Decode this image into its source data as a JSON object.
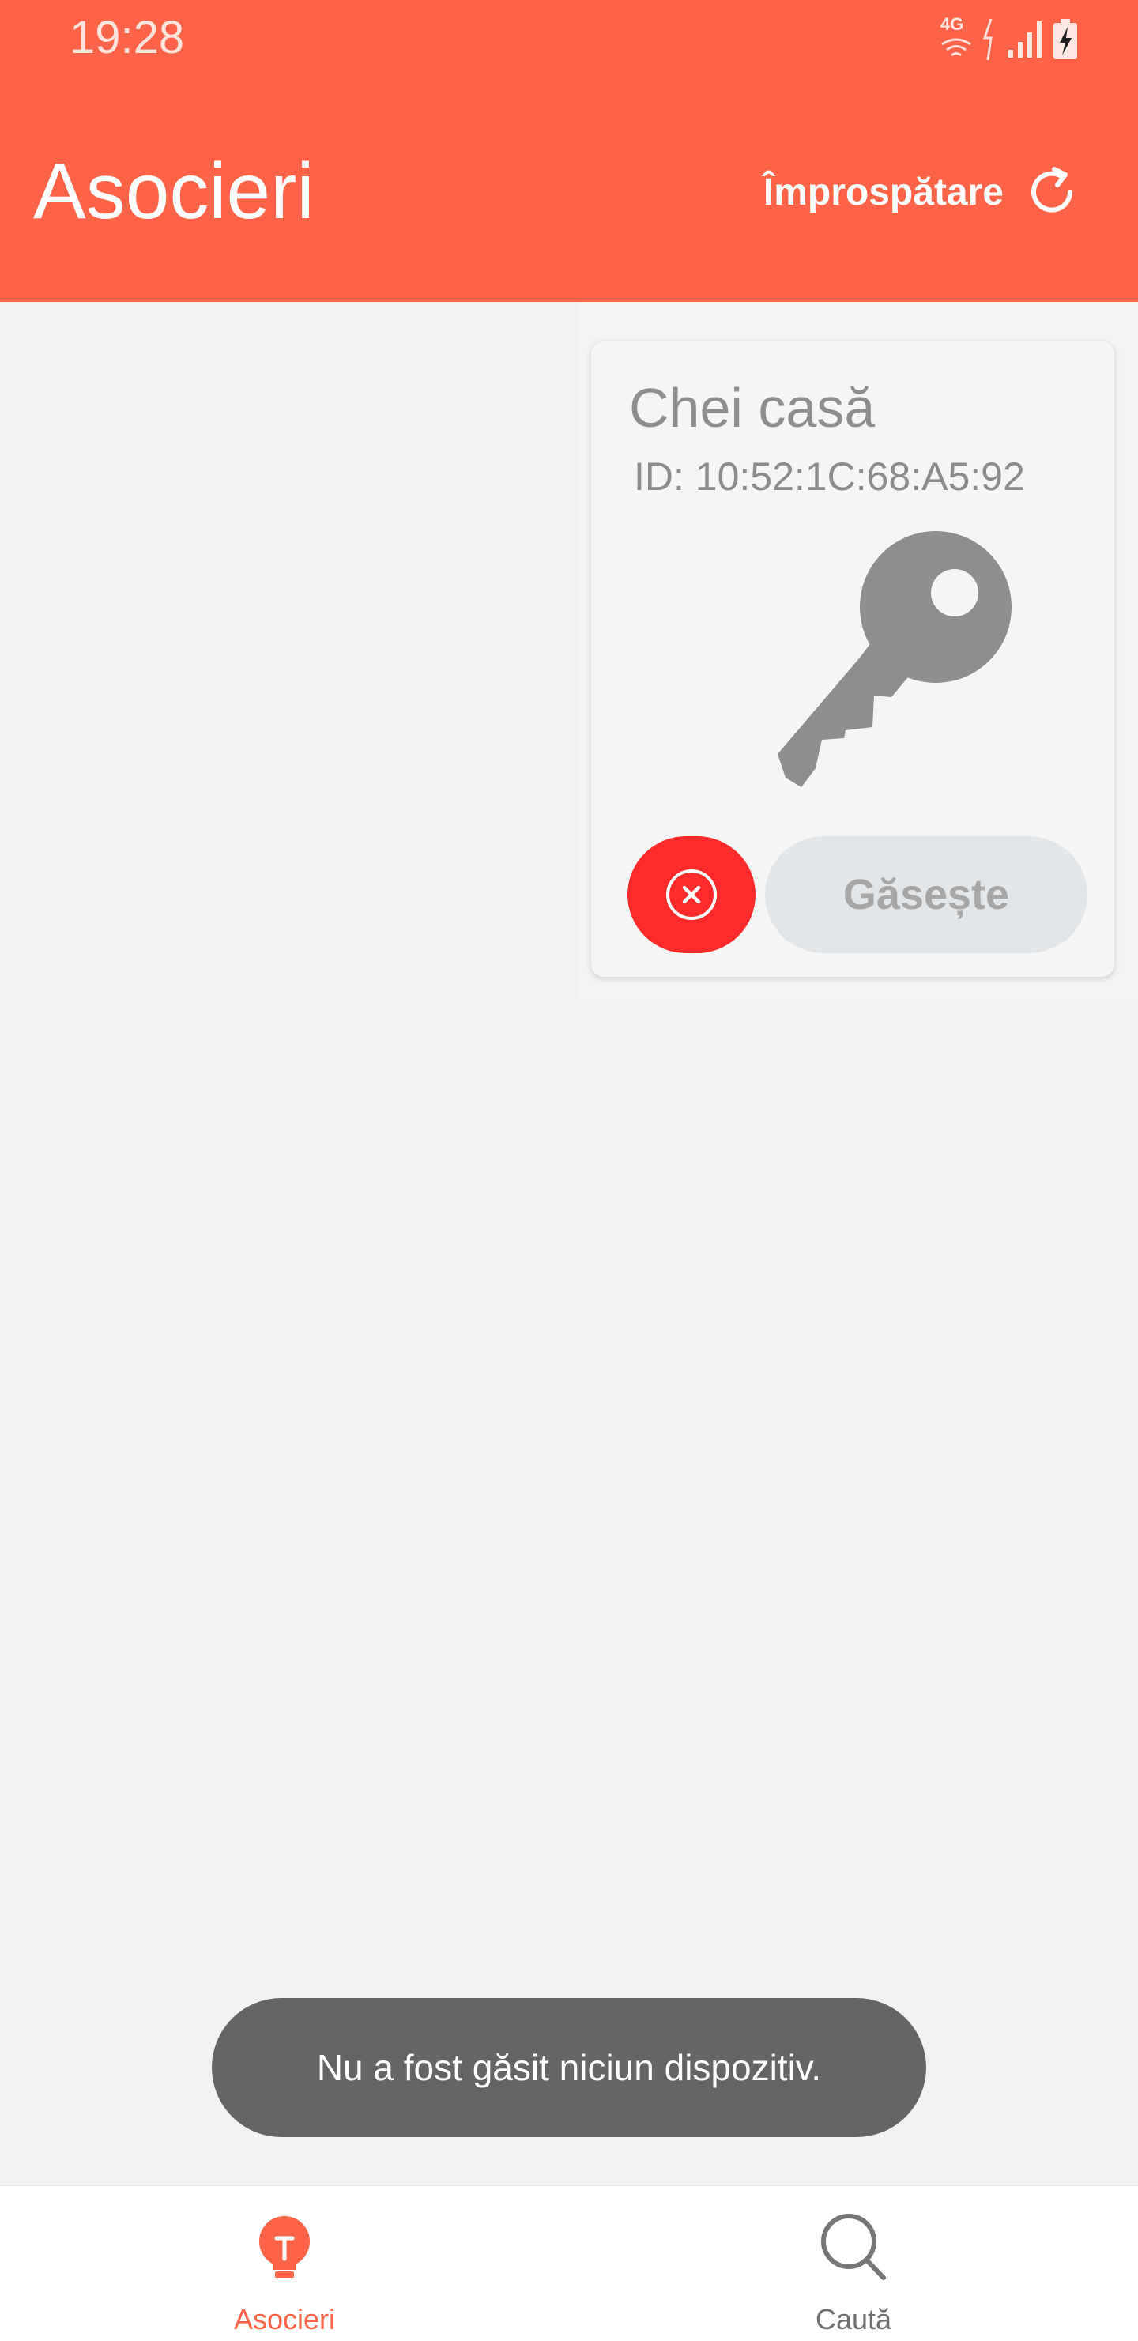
{
  "status_bar": {
    "time": "19:28",
    "network": "4G",
    "icons": [
      "wifi-icon",
      "data-transfer-icon",
      "signal-icon",
      "battery-charging-icon"
    ]
  },
  "header": {
    "title": "Asocieri",
    "refresh_label": "Împrospătare",
    "refresh_icon": "refresh-icon",
    "background": "#ff6347"
  },
  "device_card": {
    "name": "Chei casă",
    "id_text": "ID: 10:52:1C:68:A5:92",
    "icon": "key-icon",
    "remove_icon": "close-circle-icon",
    "remove_color": "#ff2a2a",
    "find_label": "Găsește"
  },
  "toast": {
    "message": "Nu a fost găsit niciun dispozitiv."
  },
  "bottom_nav": {
    "items": [
      {
        "label": "Asocieri",
        "icon": "lightbulb-icon",
        "active": true,
        "color": "#ff6347"
      },
      {
        "label": "Caută",
        "icon": "search-icon",
        "active": false,
        "color": "#777777"
      }
    ]
  }
}
